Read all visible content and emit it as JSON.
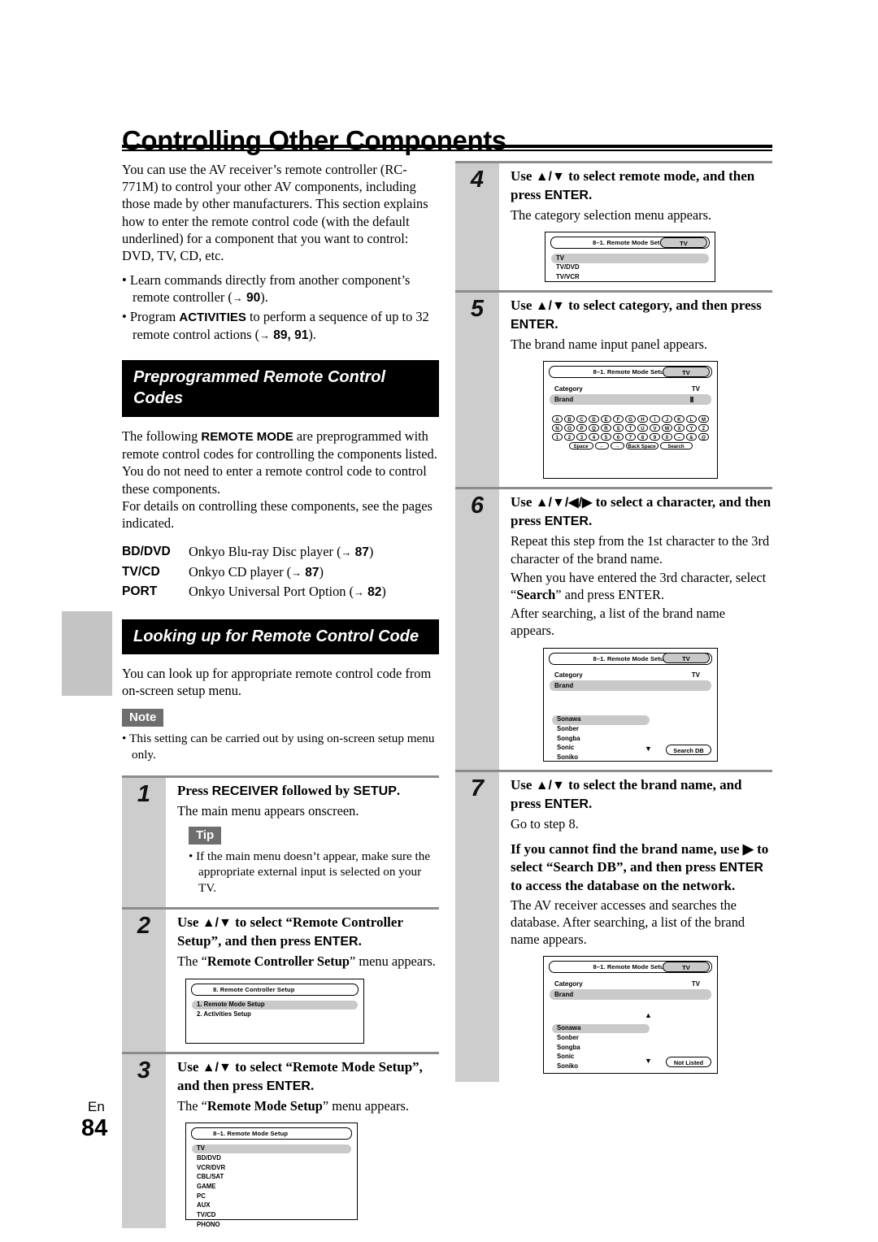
{
  "page": {
    "title": "Controlling Other Components",
    "footer_lang": "En",
    "footer_number": "84"
  },
  "left_column": {
    "intro": "You can use the AV receiver’s remote controller (RC-771M) to control your other AV components, including those made by other manufacturers. This section explains how to enter the remote control code (with the default underlined) for a component that you want to control: DVD, TV, CD, etc.",
    "bullets": [
      {
        "text_before": "Learn commands directly from another component’s remote controller (",
        "arrow": "→",
        "pages": "90",
        "text_after": ")."
      },
      {
        "text_before": "Program ",
        "bold_term": "ACTIVITIES",
        "text_mid": " to perform a sequence of up to 32 remote control actions (",
        "arrow": "→",
        "pages": "89, 91",
        "text_after": ")."
      }
    ],
    "section1": {
      "heading": "Preprogrammed Remote Control Codes",
      "para1_a": "The following ",
      "para1_b": "REMOTE MODE",
      "para1_c": " are preprogrammed with remote control codes for controlling the components listed. You do not need to enter a remote control code to control these components.",
      "para2": "For details on controlling these components, see the pages indicated.",
      "modes": [
        {
          "key": "BD/DVD",
          "desc": "Onkyo Blu-ray Disc player (",
          "page": "87",
          "tail": ")"
        },
        {
          "key": "TV/CD",
          "desc": "Onkyo CD player (",
          "page": "87",
          "tail": ")"
        },
        {
          "key": "PORT",
          "desc": "Onkyo Universal Port Option (",
          "page": "82",
          "tail": ")"
        }
      ]
    },
    "section2": {
      "heading": "Looking up for Remote Control Code",
      "para1": "You can look up for appropriate remote control code from on-screen setup menu.",
      "note_badge": "Note",
      "note_items": [
        "This setting can be carried out by using on-screen setup menu only."
      ]
    },
    "steps": [
      {
        "num": "1",
        "title_a": "Press ",
        "title_b": "RECEIVER",
        "title_c": " followed by ",
        "title_d": "SETUP",
        "title_e": ".",
        "desc": "The main menu appears onscreen.",
        "tip_badge": "Tip",
        "tip_items": [
          "If the main menu doesn’t appear, make sure the appropriate external input is selected on your TV."
        ]
      },
      {
        "num": "2",
        "title_a": "Use ",
        "title_keys": "▲/▼",
        "title_b": " to select “Remote Controller Setup”, and then press ",
        "title_d": "ENTER",
        "title_e": ".",
        "desc_a": "The “",
        "desc_b": "Remote Controller Setup",
        "desc_c": "” menu appears.",
        "osd": {
          "header": "8.   Remote Controller Setup",
          "rows": [
            {
              "label": "1.   Remote Mode Setup",
              "selected": true
            },
            {
              "label": "2.   Activities Setup",
              "selected": false
            }
          ]
        }
      },
      {
        "num": "3",
        "title_a": "Use ",
        "title_keys": "▲/▼",
        "title_b": " to select “Remote Mode Setup”, and then press ",
        "title_d": "ENTER",
        "title_e": ".",
        "desc_a": "The “",
        "desc_b": "Remote Mode Setup",
        "desc_c": "” menu appears.",
        "osd": {
          "header": "8–1.   Remote Mode Setup",
          "rows": [
            {
              "label": "TV",
              "selected": true
            },
            {
              "label": "BD/DVD",
              "selected": false
            },
            {
              "label": "VCR/DVR",
              "selected": false
            },
            {
              "label": "CBL/SAT",
              "selected": false
            },
            {
              "label": "GAME",
              "selected": false
            },
            {
              "label": "PC",
              "selected": false
            },
            {
              "label": "AUX",
              "selected": false
            },
            {
              "label": "TV/CD",
              "selected": false
            },
            {
              "label": "PHONO",
              "selected": false
            }
          ]
        }
      }
    ]
  },
  "right_column": {
    "steps": [
      {
        "num": "4",
        "title_a": "Use ",
        "title_keys": "▲/▼",
        "title_b": " to select remote mode, and then press ",
        "title_d": "ENTER",
        "title_e": ".",
        "desc": "The category selection menu appears.",
        "osd": {
          "header": "8–1.   Remote Mode Setup",
          "pill": "TV",
          "rows": [
            {
              "label": "TV",
              "selected": true
            },
            {
              "label": "TV/DVD",
              "selected": false
            },
            {
              "label": "TV/VCR",
              "selected": false
            }
          ]
        }
      },
      {
        "num": "5",
        "title_a": "Use ",
        "title_keys": "▲/▼",
        "title_b": " to select category, and then press ",
        "title_d": "ENTER",
        "title_e": ".",
        "desc": "The brand name input panel appears.",
        "osd": {
          "header": "8–1.   Remote Mode Setup",
          "pill": "TV",
          "fields": [
            {
              "key": "Category",
              "value": "TV",
              "selected": false
            },
            {
              "key": "Brand",
              "value": "",
              "selected": true
            }
          ],
          "keyboard": {
            "row1": [
              "A",
              "B",
              "C",
              "D",
              "E",
              "F",
              "G",
              "H",
              "I",
              "J",
              "K",
              "L",
              "M"
            ],
            "row2": [
              "N",
              "O",
              "P",
              "Q",
              "R",
              "S",
              "T",
              "U",
              "V",
              "W",
              "X",
              "Y",
              "Z"
            ],
            "row3": [
              "1",
              "2",
              "3",
              "4",
              "5",
              "6",
              "7",
              "8",
              "9",
              "0",
              "–",
              "&",
              "@"
            ],
            "row4": [
              "Space",
              "←",
              "→",
              "Back Space",
              "Search"
            ]
          }
        }
      },
      {
        "num": "6",
        "title_a": "Use ",
        "title_keys": "▲/▼/◀/▶",
        "title_b": " to select a character, and then press ",
        "title_d": "ENTER",
        "title_e": ".",
        "desc1": "Repeat this step from the 1st character to the 3rd character of the brand name.",
        "desc2_a": "When you have entered the 3rd character, select “",
        "desc2_b": "Search",
        "desc2_c": "” and press ",
        "desc2_d": "ENTER",
        "desc2_e": ".",
        "desc3": "After searching, a list of the brand name appears.",
        "osd": {
          "header": "8–1.   Remote Mode Setup",
          "pill": "TV",
          "fields": [
            {
              "key": "Category",
              "value": "TV",
              "selected": false
            },
            {
              "key": "Brand",
              "value": "",
              "selected": true
            }
          ],
          "brands": [
            {
              "label": "Sonawa",
              "selected": true
            },
            {
              "label": "Sonber",
              "selected": false
            },
            {
              "label": "Songba",
              "selected": false
            },
            {
              "label": "Sonic",
              "selected": false
            },
            {
              "label": "Soniko",
              "selected": false
            }
          ],
          "scroll_down": "▼",
          "button": "Search DB"
        }
      },
      {
        "num": "7",
        "title_a": "Use ",
        "title_keys": "▲/▼",
        "title_b": " to select the brand name, and press ",
        "title_d": "ENTER",
        "title_e": ".",
        "desc1": "Go to step 8.",
        "bold_para_a": "If you cannot find the brand name, use ",
        "bold_para_key": "▶",
        "bold_para_b": " to select “Search DB”, and then press ",
        "bold_para_c": "ENTER",
        "bold_para_d": " to access the database on the network.",
        "desc2": "The AV receiver accesses and searches the database. After searching, a list of the brand name appears.",
        "osd": {
          "header": "8–1.   Remote Mode Setup",
          "pill": "TV",
          "fields": [
            {
              "key": "Category",
              "value": "TV",
              "selected": false
            },
            {
              "key": "Brand",
              "value": "",
              "selected": true
            }
          ],
          "scroll_up": "▲",
          "brands": [
            {
              "label": "Sonawa",
              "selected": true
            },
            {
              "label": "Sonber",
              "selected": false
            },
            {
              "label": "Songba",
              "selected": false
            },
            {
              "label": "Sonic",
              "selected": false
            },
            {
              "label": "Soniko",
              "selected": false
            }
          ],
          "scroll_down": "▼",
          "button": "Not Listed"
        }
      }
    ]
  }
}
